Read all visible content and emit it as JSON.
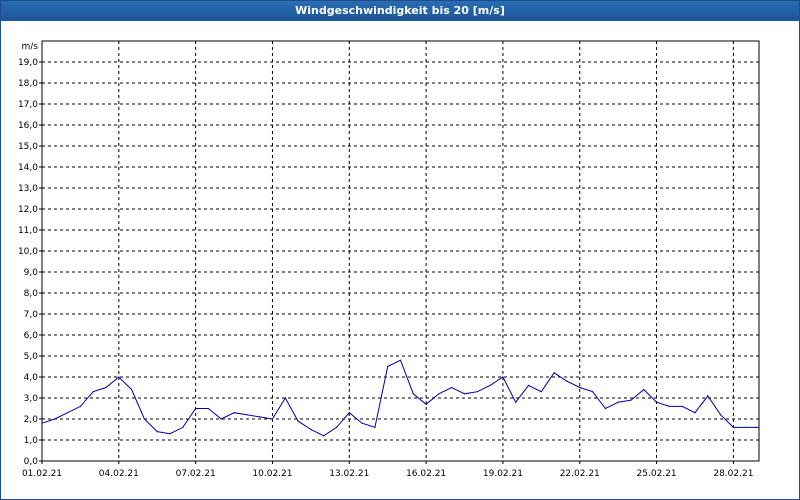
{
  "window": {
    "title": "Windgeschwindigkeit bis 20 [m/s]"
  },
  "chart_data": {
    "type": "line",
    "title": "Windgeschwindigkeit bis 20 [m/s]",
    "ylabel": "m/s",
    "ylim": [
      0,
      20
    ],
    "xlim": [
      "01.02.21",
      "01.03.21"
    ],
    "grid": true,
    "legend": "none",
    "colors": {
      "line": "#0000aa",
      "grid": "#000000",
      "titlebar": "#1d5596"
    },
    "x_ticks": [
      "01.02.21",
      "04.02.21",
      "07.02.21",
      "10.02.21",
      "13.02.21",
      "16.02.21",
      "19.02.21",
      "22.02.21",
      "25.02.21",
      "28.02.21"
    ],
    "y_ticks": [
      "0,0",
      "1,0",
      "2,0",
      "3,0",
      "4,0",
      "5,0",
      "6,0",
      "7,0",
      "8,0",
      "9,0",
      "10,0",
      "11,0",
      "12,0",
      "13,0",
      "14,0",
      "15,0",
      "16,0",
      "17,0",
      "18,0",
      "19,0"
    ],
    "series": [
      {
        "x": [
          "01.02.21 00:00",
          "01.02.21 12:00",
          "02.02.21 00:00",
          "02.02.21 12:00",
          "03.02.21 00:00",
          "03.02.21 12:00",
          "04.02.21 00:00",
          "04.02.21 12:00",
          "05.02.21 00:00",
          "05.02.21 12:00",
          "06.02.21 00:00",
          "06.02.21 12:00",
          "07.02.21 00:00",
          "07.02.21 12:00",
          "08.02.21 00:00",
          "08.02.21 12:00",
          "09.02.21 00:00",
          "09.02.21 12:00",
          "10.02.21 00:00",
          "10.02.21 12:00",
          "11.02.21 00:00",
          "11.02.21 12:00",
          "12.02.21 00:00",
          "12.02.21 12:00",
          "13.02.21 00:00",
          "13.02.21 12:00",
          "14.02.21 00:00",
          "14.02.21 12:00",
          "15.02.21 00:00",
          "15.02.21 12:00",
          "16.02.21 00:00",
          "16.02.21 12:00",
          "17.02.21 00:00",
          "17.02.21 12:00",
          "18.02.21 00:00",
          "18.02.21 12:00",
          "19.02.21 00:00",
          "19.02.21 12:00",
          "20.02.21 00:00",
          "20.02.21 12:00",
          "21.02.21 00:00",
          "21.02.21 12:00",
          "22.02.21 00:00",
          "22.02.21 12:00",
          "23.02.21 00:00",
          "23.02.21 12:00",
          "24.02.21 00:00",
          "24.02.21 12:00",
          "25.02.21 00:00",
          "25.02.21 12:00",
          "26.02.21 00:00",
          "26.02.21 12:00",
          "27.02.21 00:00",
          "27.02.21 12:00",
          "28.02.21 00:00",
          "28.02.21 12:00",
          "01.03.21 00:00"
        ],
        "values": [
          1.8,
          2.0,
          2.3,
          2.6,
          3.3,
          3.5,
          4.0,
          3.4,
          2.0,
          1.4,
          1.3,
          1.6,
          2.5,
          2.5,
          2.0,
          2.3,
          2.2,
          2.1,
          2.0,
          3.0,
          1.9,
          1.5,
          1.2,
          1.6,
          2.3,
          1.8,
          1.6,
          4.5,
          4.8,
          3.2,
          2.7,
          3.2,
          3.5,
          3.2,
          3.3,
          3.6,
          4.0,
          2.8,
          3.6,
          3.3,
          4.2,
          3.8,
          3.5,
          3.3,
          2.5,
          2.8,
          2.9,
          3.4,
          2.8,
          2.6,
          2.6,
          2.3,
          3.1,
          2.2,
          1.6,
          1.6,
          1.6
        ]
      }
    ]
  }
}
